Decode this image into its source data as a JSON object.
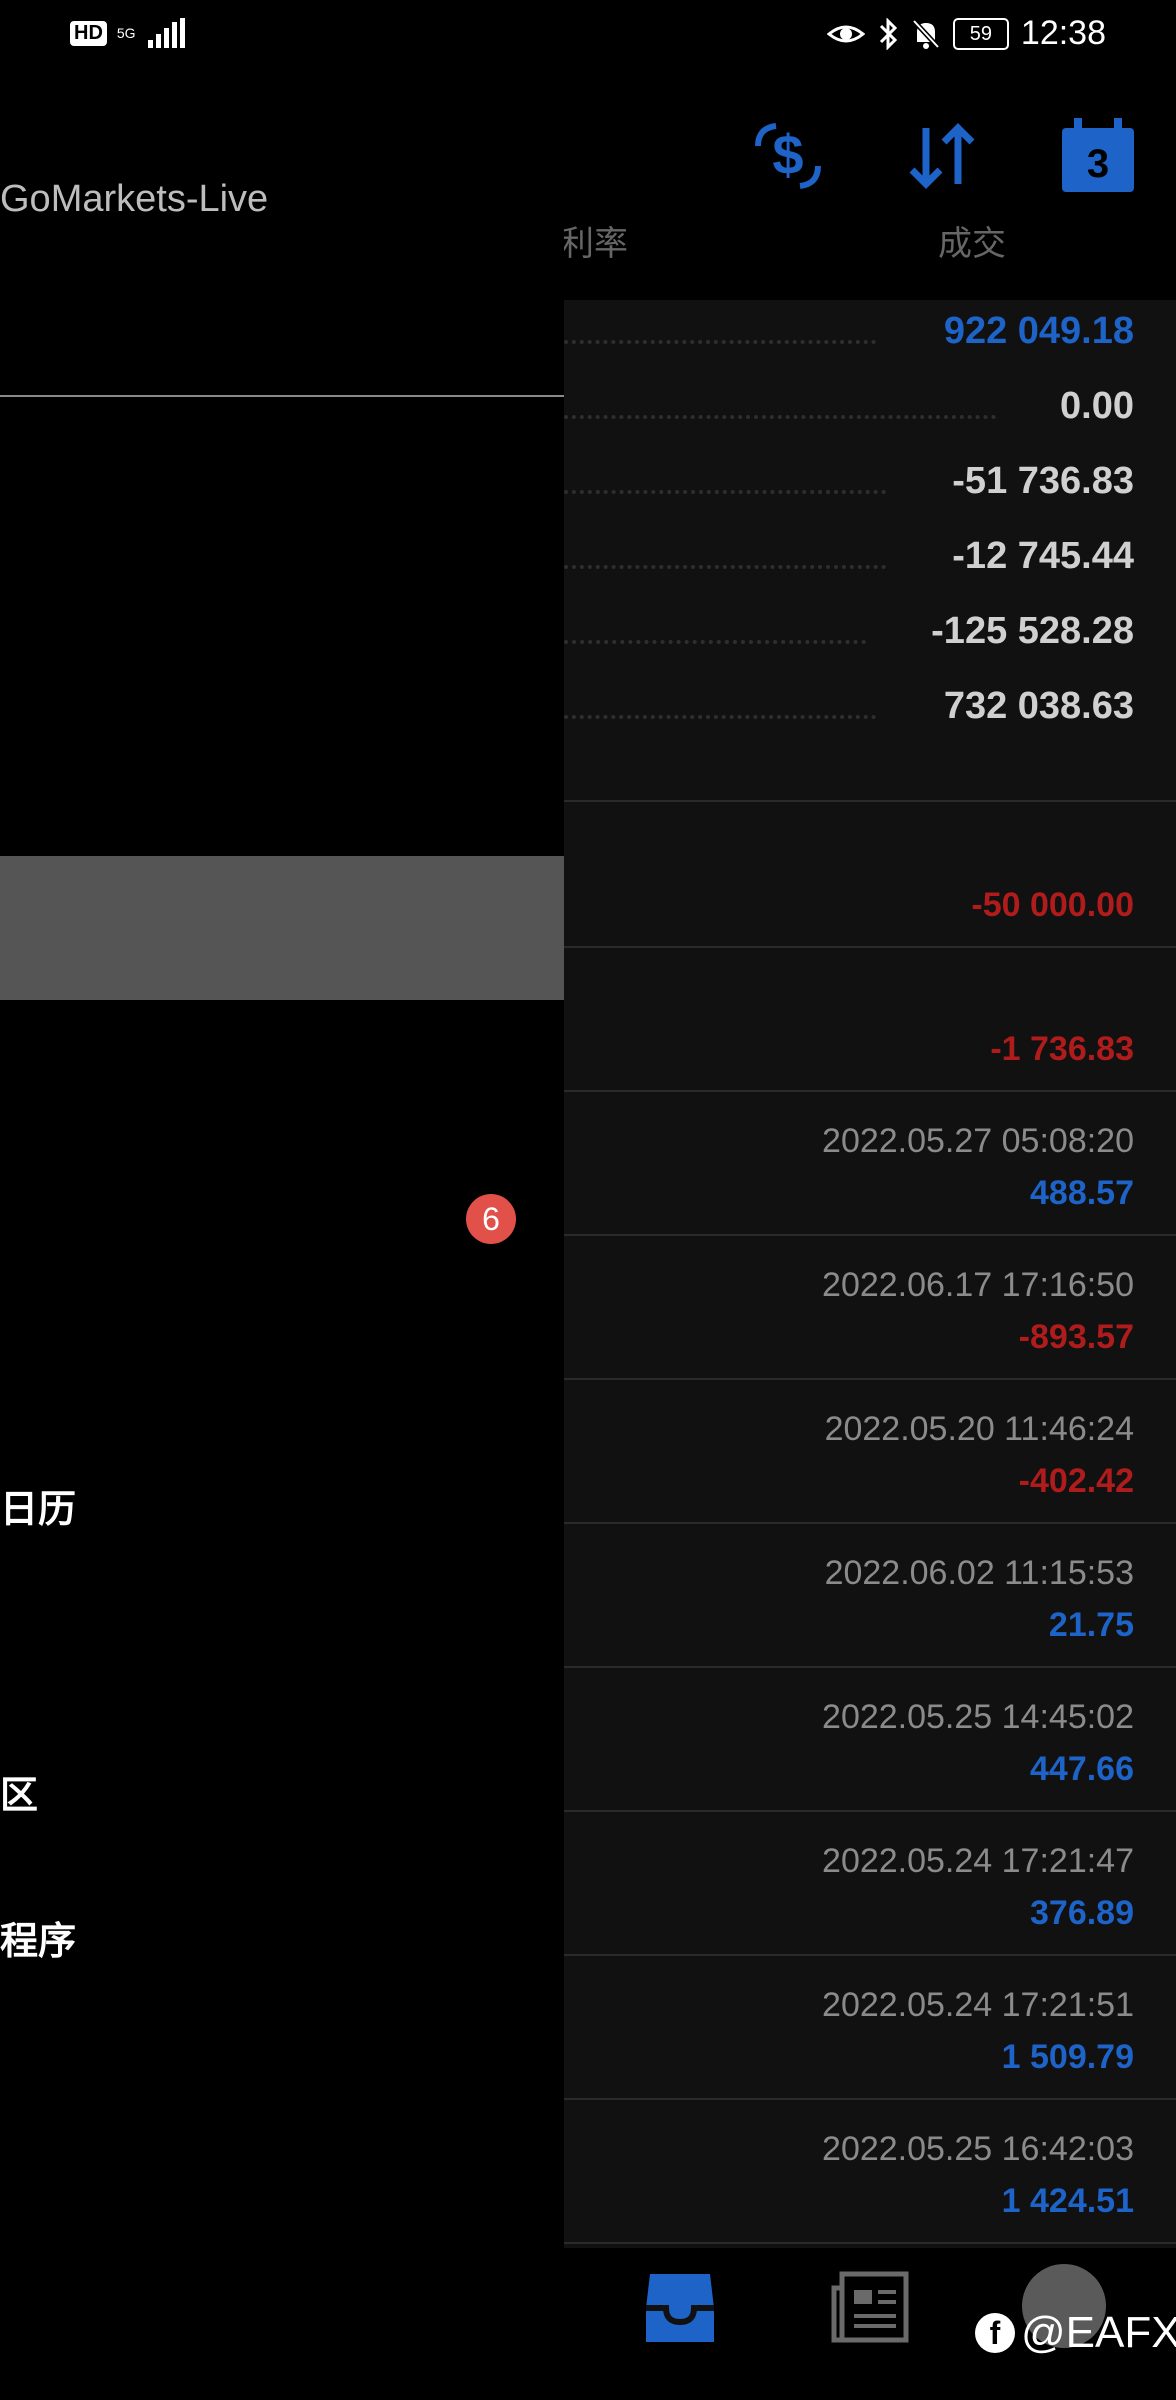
{
  "status_bar": {
    "hd": "HD",
    "network": "5G",
    "battery": "59",
    "time": "12:38"
  },
  "header": {
    "account_title": "GoMarkets-Live",
    "calendar_day": "3",
    "column_headers": [
      "利率",
      "成交"
    ]
  },
  "summary": [
    {
      "value": "922 049.18",
      "color": "#1e63c8"
    },
    {
      "value": "0.00",
      "color": "#d0d0d0"
    },
    {
      "value": "-51 736.83",
      "color": "#d0d0d0"
    },
    {
      "value": "-12 745.44",
      "color": "#d0d0d0"
    },
    {
      "value": "-125 528.28",
      "color": "#d0d0d0"
    },
    {
      "value": "732 038.63",
      "color": "#d0d0d0"
    }
  ],
  "adjustments": [
    {
      "value": "-50 000.00",
      "color": "#b01c1c"
    },
    {
      "value": "-1 736.83",
      "color": "#b01c1c"
    }
  ],
  "trades": [
    {
      "date": "2022.05.27 05:08:20",
      "value": "488.57",
      "color": "#1e63c8"
    },
    {
      "date": "2022.06.17 17:16:50",
      "value": "-893.57",
      "color": "#b01c1c"
    },
    {
      "date": "2022.05.20 11:46:24",
      "value": "-402.42",
      "color": "#b01c1c"
    },
    {
      "date": "2022.06.02 11:15:53",
      "value": "21.75",
      "color": "#1e63c8"
    },
    {
      "date": "2022.05.25 14:45:02",
      "value": "447.66",
      "color": "#1e63c8"
    },
    {
      "date": "2022.05.24 17:21:47",
      "value": "376.89",
      "color": "#1e63c8"
    },
    {
      "date": "2022.05.24 17:21:51",
      "value": "1 509.79",
      "color": "#1e63c8"
    },
    {
      "date": "2022.05.25 16:42:03",
      "value": "1 424.51",
      "color": "#1e63c8"
    }
  ],
  "drawer": {
    "badge": "6",
    "items": [
      "日历",
      "区",
      "程序"
    ]
  },
  "watermark": {
    "text": "@EAFX"
  },
  "icons": {
    "currency": "dollar-exchange-icon",
    "sort": "sort-arrows-icon",
    "calendar": "calendar-icon",
    "inbox": "inbox-icon",
    "news": "news-icon"
  }
}
